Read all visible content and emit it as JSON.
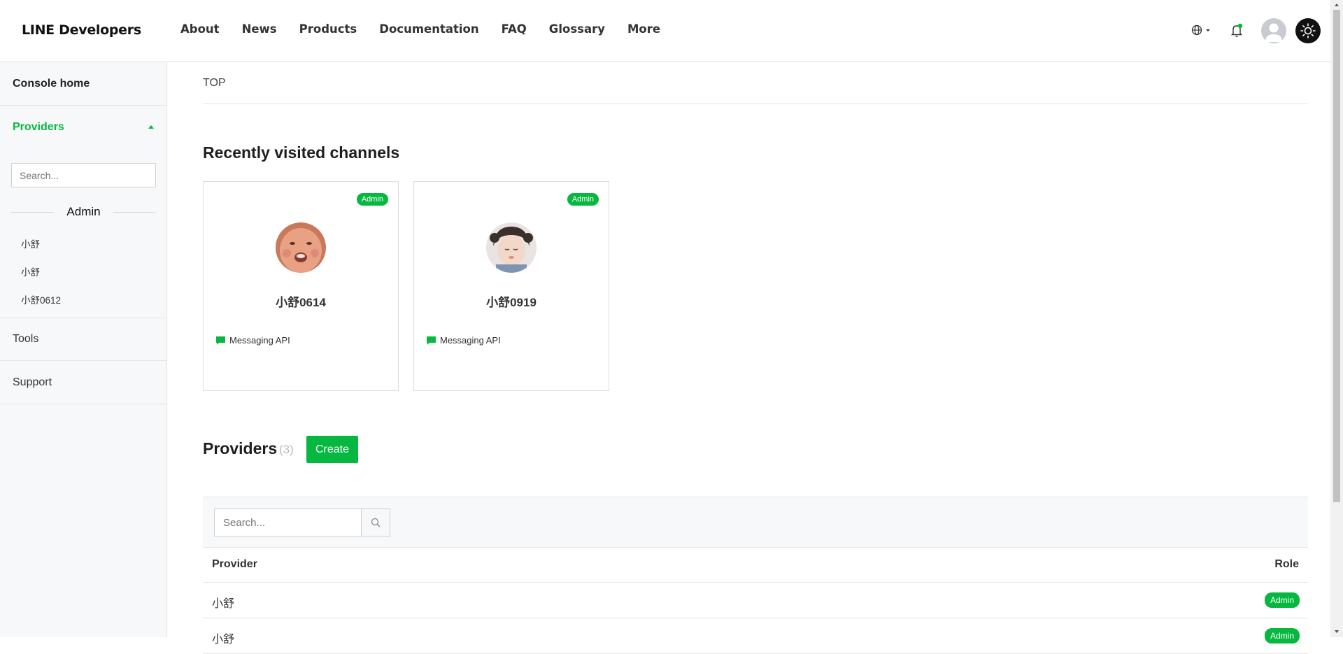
{
  "header": {
    "logo": "LINE Developers",
    "nav": [
      "About",
      "News",
      "Products",
      "Documentation",
      "FAQ",
      "Glossary",
      "More"
    ]
  },
  "sidebar": {
    "console_home": "Console home",
    "providers_label": "Providers",
    "search_placeholder": "Search...",
    "group_label": "Admin",
    "providers": [
      "小舒",
      "小舒",
      "小舒0612"
    ],
    "tools": "Tools",
    "support": "Support"
  },
  "main": {
    "breadcrumb": "TOP",
    "recent_title": "Recently visited channels",
    "channels": [
      {
        "name": "小舒0614",
        "role": "Admin",
        "type": "Messaging API"
      },
      {
        "name": "小舒0919",
        "role": "Admin",
        "type": "Messaging API"
      }
    ],
    "providers_title": "Providers",
    "providers_count": "(3)",
    "create_label": "Create",
    "filter_placeholder": "Search...",
    "table": {
      "columns": [
        "Provider",
        "Role"
      ],
      "rows": [
        {
          "provider": "小舒",
          "role": "Admin"
        },
        {
          "provider": "小舒",
          "role": "Admin"
        }
      ]
    }
  },
  "colors": {
    "accent": "#06b83f"
  }
}
